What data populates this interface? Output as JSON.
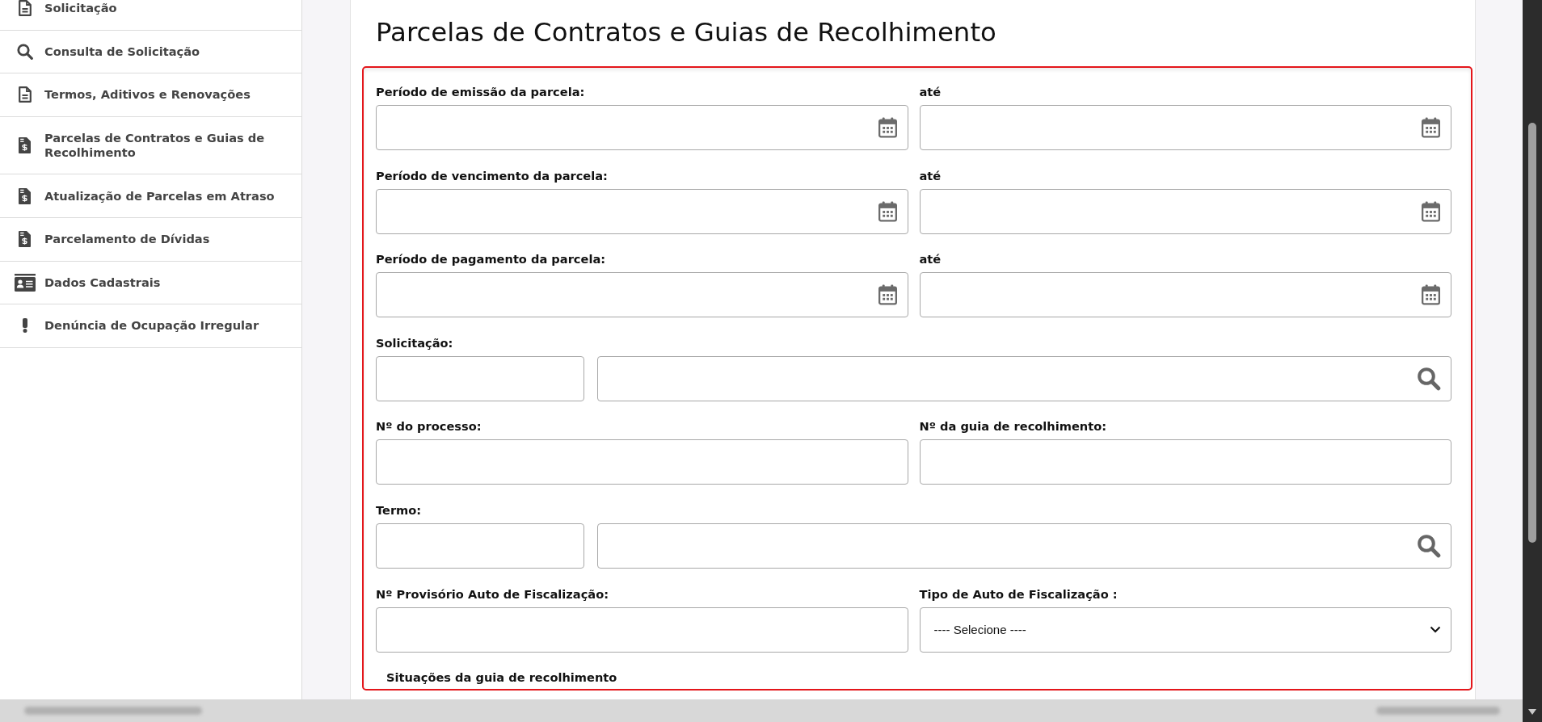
{
  "sidebar": {
    "items": [
      {
        "label": "Solicitação",
        "kind": "document"
      },
      {
        "label": "Consulta de Solicitação",
        "kind": "search"
      },
      {
        "label": "Termos, Aditivos e Renovações",
        "kind": "document"
      },
      {
        "label": "Parcelas de Contratos e Guias de Recolhimento",
        "kind": "money-document"
      },
      {
        "label": "Atualização de Parcelas em Atraso",
        "kind": "money-document"
      },
      {
        "label": "Parcelamento de Dívidas",
        "kind": "money-document"
      },
      {
        "label": "Dados Cadastrais",
        "kind": "id-card"
      },
      {
        "label": "Denúncia de Ocupação Irregular",
        "kind": "alert"
      }
    ]
  },
  "page": {
    "title": "Parcelas de Contratos e Guias de Recolhimento"
  },
  "filter_form": {
    "rows": [
      {
        "fields": [
          {
            "kind": "date",
            "label": "Período de emissão da parcela:"
          },
          {
            "kind": "date",
            "label": "até"
          }
        ]
      },
      {
        "fields": [
          {
            "kind": "date",
            "label": "Período de vencimento da parcela:"
          },
          {
            "kind": "date",
            "label": "até"
          }
        ]
      },
      {
        "fields": [
          {
            "kind": "date",
            "label": "Período de pagamento da parcela:"
          },
          {
            "kind": "date",
            "label": "até"
          }
        ]
      },
      {
        "fields": [
          {
            "kind": "lookup",
            "label": "Solicitação:"
          }
        ]
      },
      {
        "fields": [
          {
            "kind": "text",
            "label": "Nº do processo:"
          },
          {
            "kind": "text",
            "label": "Nº da guia de recolhimento:"
          }
        ]
      },
      {
        "fields": [
          {
            "kind": "lookup",
            "label": "Termo:"
          }
        ]
      },
      {
        "fields": [
          {
            "kind": "text",
            "label": "Nº Provisório Auto de Fiscalização:"
          },
          {
            "kind": "select",
            "label": "Tipo de Auto de Fiscalização :",
            "value": "---- Selecione ----"
          }
        ]
      }
    ],
    "section_label": "Situações da guia de recolhimento"
  }
}
